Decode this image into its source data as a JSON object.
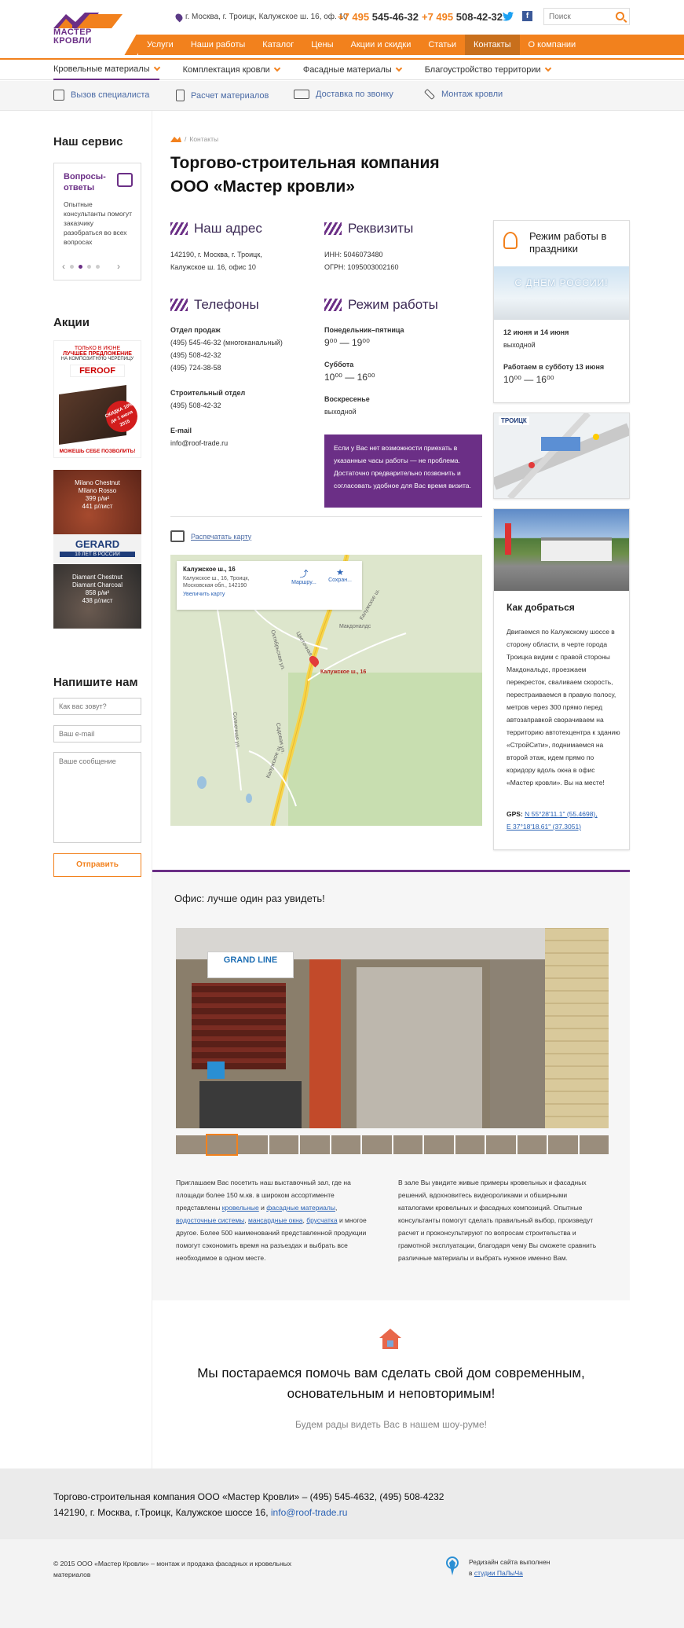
{
  "header": {
    "logo_line1": "МАСТЕР",
    "logo_line2": "КРОВЛИ",
    "address": "г. Москва, г. Троицк, Калужское ш. 16, оф. 10",
    "phone1_code": "+7 495",
    "phone1_num": "545-46-32",
    "phone2_code": "+7 495",
    "phone2_num": "508-42-32",
    "search_placeholder": "Поиск",
    "brand_color": "#f2811d",
    "accent_color": "#6b2f86"
  },
  "topnav": [
    "Услуги",
    "Наши работы",
    "Каталог",
    "Цены",
    "Акции и скидки",
    "Статьи",
    "Контакты",
    "О компании"
  ],
  "catnav": [
    "Кровельные материалы",
    "Комплектация кровли",
    "Фасадные материалы",
    "Благоустройство территории"
  ],
  "services": [
    "Вызов специалиста",
    "Расчет материалов",
    "Доставка по звонку",
    "Монтаж кровли"
  ],
  "sidebar": {
    "service_heading": "Наш сервис",
    "svc_title": "Вопросы-ответы",
    "svc_text": "Опытные консультанты помогут заказчику разобраться во всех вопросах",
    "promo_heading": "Акции",
    "promo1_top": "ТОЛЬКО В ИЮНЕ",
    "promo1_main": "ЛУЧШЕЕ ПРЕДЛОЖЕНИЕ",
    "promo1_sub": "НА КОМПОЗИТНУЮ ЧЕРЕПИЦУ",
    "promo1_brand": "FEROOF",
    "promo1_badge": "СКИДКА 10% до 1 июля 2015",
    "promo1_footer": "МОЖЕШЬ СЕБЕ ПОЗВОЛИТЬ!",
    "promo2_l1": "Milano Chestnut",
    "promo2_l2": "Milano Rosso",
    "promo2_l3": "399 р/м²",
    "promo2_l4": "441 р/лист",
    "promo3_brand": "GERARD",
    "promo3_sub": "10 ЛЕТ В РОССИИ",
    "promo4_l1": "Diamant Chestnut",
    "promo4_l2": "Diamant Charcoal",
    "promo4_l3": "858 р/м²",
    "promo4_l4": "438 р/лист",
    "form_heading": "Напишите нам",
    "name_ph": "Как вас зовут?",
    "email_ph": "Ваш e-mail",
    "msg_ph": "Ваше сообщение",
    "send": "Отправить"
  },
  "main": {
    "crumb": "Контакты",
    "title_l1": "Торгово-строительная компания",
    "title_l2": "ООО «Мастер кровли»",
    "addr_h": "Наш адрес",
    "addr_l1": "142190, г. Москва, г. Троицк,",
    "addr_l2": "Калужское ш. 16, офис 10",
    "req_h": "Реквизиты",
    "req_l1": "ИНН: 5046073480",
    "req_l2": "ОГРН: 1095003002160",
    "tel_h": "Телефоны",
    "sales_h": "Отдел продаж",
    "sales_1": "(495) 545-46-32 (многоканальный)",
    "sales_2": "(495) 508-42-32",
    "sales_3": "(495) 724-38-58",
    "build_h": "Строительный отдел",
    "build_1": "(495) 508-42-32",
    "email_h": "E-mail",
    "email": "info@roof-trade.ru",
    "mode_h": "Режим работы",
    "wd_h": "Понедельник–пятница",
    "wd": "9⁰⁰ — 19⁰⁰",
    "sat_h": "Суббота",
    "sat": "10⁰⁰ — 16⁰⁰",
    "sun_h": "Воскресенье",
    "sun": "выходной",
    "note": "Если у Вас нет возможности приехать в указанные часы работы — не проблема. Достаточно предварительно позвонить и согласовать удобное для Вас время визита.",
    "print": "Распечатать карту",
    "map_title": "Калужское ш., 16",
    "map_addr1": "Калужское ш., 16, Троицк,",
    "map_addr2": "Московская обл., 142190",
    "map_zoom": "Увеличить карту",
    "map_route": "Маршру...",
    "map_save": "Сохран...",
    "map_pin": "Калужское ш., 16",
    "map_labels": [
      "Октябрьская ул.",
      "Цветочная ул.",
      "Макдоналдс",
      "Калужское ш.",
      "Садовая ул.",
      "Солнечная ул.",
      "Калужское ш."
    ]
  },
  "right": {
    "holiday_h": "Режим работы в праздники",
    "holiday_banner": "С ДНЕМ РОССИИ!",
    "h1_date": "12 июня и 14 июня",
    "h1_val": "выходной",
    "h2_date": "Работаем в субботу 13 июня",
    "h2_val": "10⁰⁰ — 16⁰⁰",
    "scheme_label": "ТРОИЦК",
    "howto_h": "Как добраться",
    "howto_text": "Двигаемся по Калужскому шоссе в сторону области, в черте города Троицка видим с правой стороны Макдональдс, проезжаем перекресток, сваливаем скорость, перестраиваемся в правую полосу, метров через 300 прямо перед автозаправкой сворачиваем на территорию автотехцентра к зданию «СтройСити», поднимаемся на второй этаж, идем прямо по коридору вдоль окна в офис «Мастер кровли». Вы на месте!",
    "gps_label": "GPS:",
    "gps_n": "N 55°28'11.1\" (55.4698),",
    "gps_e": "E 37°18'18.61\" (37.3051)"
  },
  "office": {
    "title": "Офис: лучше один раз увидеть!",
    "photo_sign": "GRAND LINE",
    "left_text_1": "Приглашаем Вас посетить наш выставочный зал, где на площади более 150 м.кв. в широком ассортименте представлены ",
    "link_roof": "кровельные",
    "and": " и ",
    "link_facade": "фасадные материалы",
    "comma": ", ",
    "link_drain": "водосточные системы",
    "link_attic": "мансардные окна",
    "link_beams": "брусчатка",
    "left_text_2": " и многое другое. Более 500 наименований представленной продукции помогут сэкономить время на разъездах и выбрать все необходимое в одном месте.",
    "right_text": "В зале Вы увидите живые примеры кровельных и фасадных решений, вдохновитесь видеороликами и обширными каталогами кровельных и фасадных композиций. Опытные консультанты помогут сделать правильный выбор, произведут расчет и проконсультируют по вопросам строительства и грамотной эксплуатации, благодаря чему Вы сможете сравнить различные материалы и выбрать нужное именно Вам."
  },
  "cta": {
    "l1": "Мы постараемся помочь вам сделать свой дом современным,",
    "l2": "основательным и неповторимым!",
    "sub": "Будем рады видеть Вас в нашем шоу-руме!"
  },
  "footer": {
    "l1": "Торгово-строительная компания ООО «Мастер Кровли» – (495) 545-4632, (495) 508-4232",
    "l2": "142190, г. Москва, г.Троицк, Калужское шоссе 16, ",
    "email": "info@roof-trade.ru",
    "copy1": "© 2015 ООО «Мастер Кровли» – монтаж и продажа фасадных и кровельных",
    "copy2": "материалов",
    "dev1": "Редизайн сайта выполнен",
    "dev2": "в ",
    "dev_link": "студии ПаЛыЧа"
  }
}
